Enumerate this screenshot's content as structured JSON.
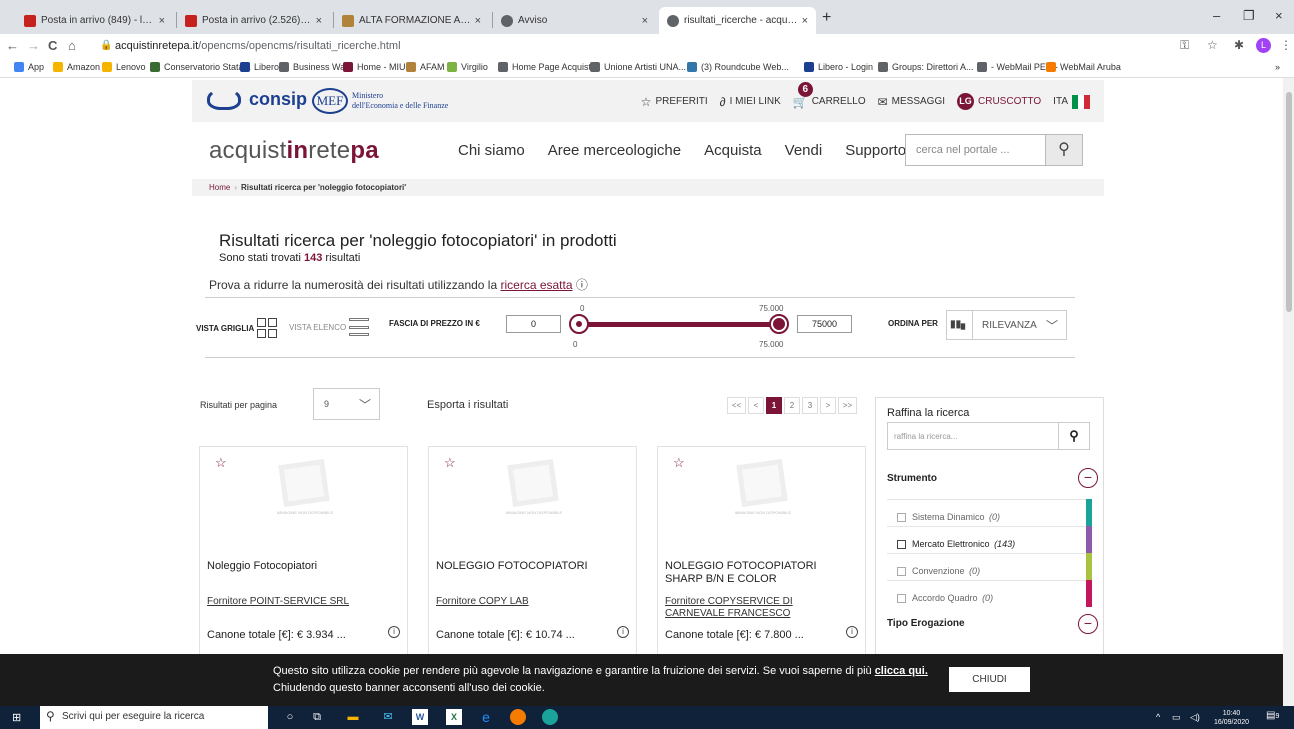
{
  "browser": {
    "tabs": [
      {
        "title": "Posta in arrivo (849) - l.garreffa@",
        "icon": "gmail-icon",
        "color": "#c5221f"
      },
      {
        "title": "Posta in arrivo (2.526) - letiziaga",
        "icon": "gmail-icon",
        "color": "#c5221f"
      },
      {
        "title": "ALTA FORMAZIONE ARTISTICA M",
        "icon": "ministry-icon",
        "color": "#b0823a"
      },
      {
        "title": "Avviso",
        "icon": "globe-icon",
        "color": "#5f6368"
      },
      {
        "title": "risultati_ricerche - acquistinretep",
        "icon": "globe-icon",
        "color": "#5f6368"
      }
    ],
    "close_glyph": "×",
    "new_tab": "+",
    "window_controls": [
      "–",
      "❐",
      "×"
    ],
    "url_host": "acquistinretepa.it",
    "url_path": "/opencms/opencms/risultati_ricerche.html",
    "nav": {
      "back": "←",
      "forward": "→",
      "reload": "C",
      "home": "⌂"
    },
    "profile_initial": "L",
    "bookmarks": [
      {
        "label": "App",
        "color": "#4285f4"
      },
      {
        "label": "Amazon",
        "color": "#f4b400"
      },
      {
        "label": "Lenovo",
        "color": "#f4b400"
      },
      {
        "label": "Conservatorio Stata...",
        "color": "#3a6b35"
      },
      {
        "label": "Libero",
        "color": "#1c3f8f"
      },
      {
        "label": "Business Way",
        "color": "#5f6368"
      },
      {
        "label": "Home - MIUR",
        "color": "#7a1538"
      },
      {
        "label": "AFAM",
        "color": "#b0823a"
      },
      {
        "label": "Virgilio",
        "color": "#7cb342"
      },
      {
        "label": "Home Page Acquist...",
        "color": "#5f6368"
      },
      {
        "label": "Unione Artisti UNA...",
        "color": "#5f6368"
      },
      {
        "label": "(3) Roundcube Web...",
        "color": "#37a"
      },
      {
        "label": "Libero - Login",
        "color": "#1c3f8f"
      },
      {
        "label": "Groups: Direttori A...",
        "color": "#5f6368"
      },
      {
        "label": "- WebMail PEC -",
        "color": "#5f6368"
      },
      {
        "label": "WebMail Aruba",
        "color": "#f57c00"
      }
    ],
    "bookmarks_more": "»"
  },
  "site": {
    "consip_logo_text": "consip",
    "mef_logo": "MEF",
    "mef_text_line1": "Ministero",
    "mef_text_line2": "dell'Economia e delle Finanze",
    "top_links": {
      "preferiti": "PREFERITI",
      "miei_link": "I MIEI LINK",
      "carrello": "CARRELLO",
      "cart_count": "6",
      "messaggi": "MESSAGGI",
      "user_initials": "LG",
      "cruscotto": "CRUSCOTTO",
      "lang": "ITA"
    },
    "brand": {
      "part1": "acquist",
      "part2": "in",
      "part3": "rete",
      "part4": "pa"
    },
    "main_nav": [
      "Chi siamo",
      "Aree merceologiche",
      "Acquista",
      "Vendi",
      "Supporto"
    ],
    "search_placeholder": "cerca nel portale ...",
    "breadcrumb": {
      "home": "Home",
      "current": "Risultati ricerca per 'noleggio fotocopiatori'"
    },
    "results_title": "Risultati ricerca per 'noleggio fotocopiatori' in prodotti",
    "results_count_prefix": "Sono stati trovati",
    "results_count": "143",
    "results_count_suffix": "risultati",
    "hint_text": "Prova a ridurre la numerosità dei risultati utilizzando la",
    "hint_link": "ricerca esatta",
    "view": {
      "grid": "VISTA GRIGLIA",
      "list": "VISTA ELENCO"
    },
    "price": {
      "label": "FASCIA DI PREZZO IN €",
      "min_value": "0",
      "max_value": "75000",
      "min_label_top": "0",
      "min_label_bottom": "0",
      "max_label_top": "75.000",
      "max_label_bottom": "75.000"
    },
    "sort": {
      "label": "ORDINA PER",
      "value": "RILEVANZA"
    },
    "per_page": {
      "label": "Risultati per pagina",
      "value": "9"
    },
    "export_label": "Esporta i risultati",
    "pager": [
      "<<",
      "<",
      "1",
      "2",
      "3",
      ">",
      ">>"
    ],
    "pager_current": "1",
    "image_placeholder": "IMMAGINE NON DISPONIBILE",
    "products": [
      {
        "name": "Noleggio Fotocopiatori",
        "supplier": "Fornitore POINT-SERVICE SRL",
        "price": "Canone totale [€]: € 3.934 ..."
      },
      {
        "name": "NOLEGGIO FOTOCOPIATORI",
        "supplier": "Fornitore COPY LAB",
        "price": "Canone totale [€]: € 10.74 ..."
      },
      {
        "name": "NOLEGGIO FOTOCOPIATORI SHARP B/N E COLOR",
        "supplier": "Fornitore COPYSERVICE DI CARNEVALE FRANCESCO",
        "price": "Canone totale [€]: € 7.800 ..."
      }
    ],
    "refine": {
      "title": "Raffina la ricerca",
      "placeholder": "raffina la ricerca...",
      "section_strumento": "Strumento",
      "section_tipo": "Tipo Erogazione",
      "options": [
        {
          "label": "Sistema Dinamico",
          "count": "(0)",
          "color": "#1aa39a"
        },
        {
          "label": "Mercato Elettronico",
          "count": "(143)",
          "color": "#8e5ba8"
        },
        {
          "label": "Convenzione",
          "count": "(0)",
          "color": "#a9c23f"
        },
        {
          "label": "Accordo Quadro",
          "count": "(0)",
          "color": "#c2185b"
        }
      ]
    },
    "cookie": {
      "line1": "Questo sito utilizza cookie per rendere più agevole la navigazione e garantire la fruizione dei servizi. Se vuoi saperne di più",
      "link": "clicca qui.",
      "line2": "Chiudendo questo banner acconsenti all'uso dei cookie.",
      "button": "CHIUDI"
    }
  },
  "taskbar": {
    "search_placeholder": "Scrivi qui per eseguire la ricerca",
    "time": "10:40",
    "date": "16/09/2020",
    "notification_count": "9"
  }
}
